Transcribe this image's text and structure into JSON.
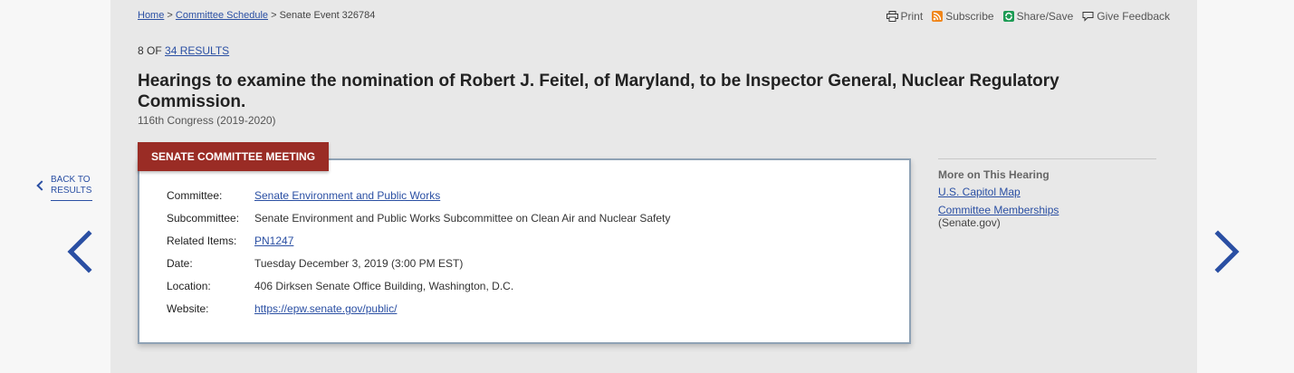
{
  "breadcrumb": {
    "home": "Home",
    "sep1": ">",
    "schedule": "Committee Schedule",
    "sep2": ">",
    "current": "Senate Event 326784"
  },
  "utility": {
    "print": "Print",
    "subscribe": "Subscribe",
    "share": "Share/Save",
    "feedback": "Give Feedback",
    "colors": {
      "rss": "#f0861b",
      "share": "#1c9b54"
    }
  },
  "results": {
    "prefix": "8 OF",
    "link": "34 RESULTS"
  },
  "title": "Hearings to examine the nomination of Robert J. Feitel, of Maryland, to be Inspector General, Nuclear Regulatory Commission.",
  "congress": "116th Congress (2019-2020)",
  "meeting_tab": "SENATE COMMITTEE MEETING",
  "details": {
    "committee": {
      "label": "Committee:",
      "value": "Senate Environment and Public Works"
    },
    "subcommittee": {
      "label": "Subcommittee:",
      "value": "Senate Environment and Public Works Subcommittee on Clean Air and Nuclear Safety"
    },
    "related": {
      "label": "Related Items:",
      "value": "PN1247"
    },
    "date": {
      "label": "Date:",
      "value": "Tuesday December 3, 2019 (3:00 PM EST)"
    },
    "location": {
      "label": "Location:",
      "value": "406 Dirksen Senate Office Building, Washington, D.C."
    },
    "website": {
      "label": "Website:",
      "value": "https://epw.senate.gov/public/"
    }
  },
  "sidebar": {
    "heading": "More on This Hearing",
    "capitol_map": "U.S. Capitol Map",
    "memberships": "Committee Memberships",
    "memberships_note": "(Senate.gov)"
  },
  "nav": {
    "back_label": "BACK TO RESULTS",
    "accent": "#2a4fa3",
    "tab_color": "#9a2c25"
  }
}
